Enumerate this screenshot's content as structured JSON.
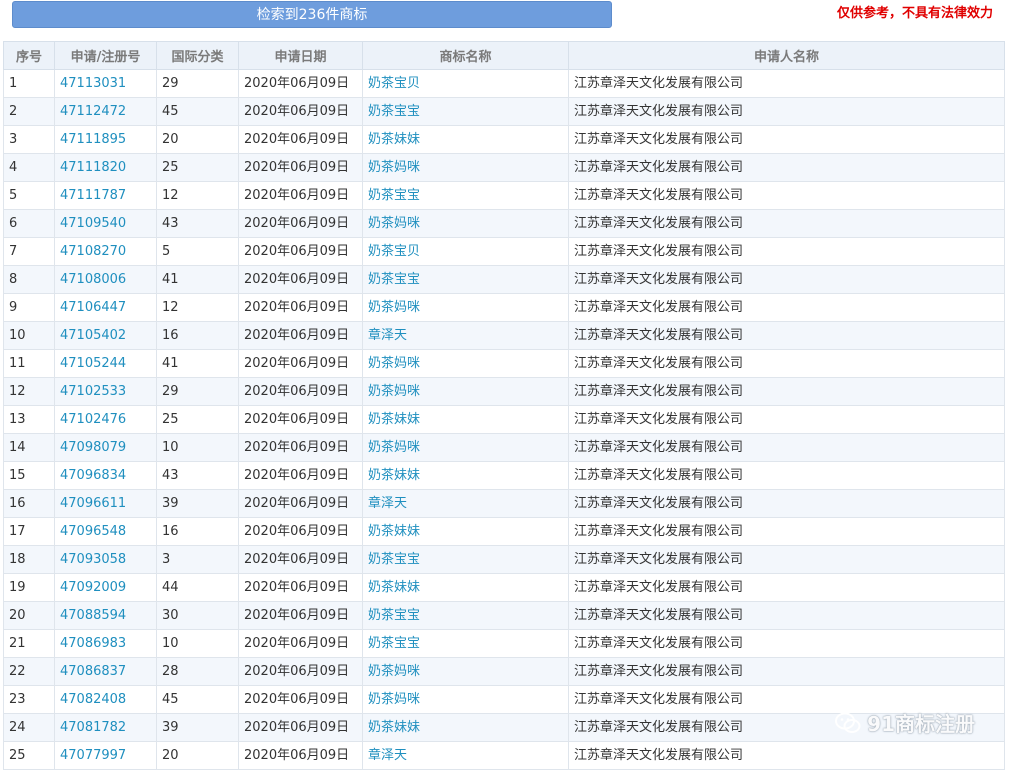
{
  "header": {
    "result_label": "检索到236件商标",
    "disclaimer": "仅供参考，不具有法律效力"
  },
  "columns": [
    "序号",
    "申请/注册号",
    "国际分类",
    "申请日期",
    "商标名称",
    "申请人名称"
  ],
  "rows": [
    {
      "no": "1",
      "reg": "47113031",
      "cls": "29",
      "date": "2020年06月09日",
      "name": "奶茶宝贝",
      "applicant": "江苏章泽天文化发展有限公司"
    },
    {
      "no": "2",
      "reg": "47112472",
      "cls": "45",
      "date": "2020年06月09日",
      "name": "奶茶宝宝",
      "applicant": "江苏章泽天文化发展有限公司"
    },
    {
      "no": "3",
      "reg": "47111895",
      "cls": "20",
      "date": "2020年06月09日",
      "name": "奶茶妹妹",
      "applicant": "江苏章泽天文化发展有限公司"
    },
    {
      "no": "4",
      "reg": "47111820",
      "cls": "25",
      "date": "2020年06月09日",
      "name": "奶茶妈咪",
      "applicant": "江苏章泽天文化发展有限公司"
    },
    {
      "no": "5",
      "reg": "47111787",
      "cls": "12",
      "date": "2020年06月09日",
      "name": "奶茶宝宝",
      "applicant": "江苏章泽天文化发展有限公司"
    },
    {
      "no": "6",
      "reg": "47109540",
      "cls": "43",
      "date": "2020年06月09日",
      "name": "奶茶妈咪",
      "applicant": "江苏章泽天文化发展有限公司"
    },
    {
      "no": "7",
      "reg": "47108270",
      "cls": "5",
      "date": "2020年06月09日",
      "name": "奶茶宝贝",
      "applicant": "江苏章泽天文化发展有限公司"
    },
    {
      "no": "8",
      "reg": "47108006",
      "cls": "41",
      "date": "2020年06月09日",
      "name": "奶茶宝宝",
      "applicant": "江苏章泽天文化发展有限公司"
    },
    {
      "no": "9",
      "reg": "47106447",
      "cls": "12",
      "date": "2020年06月09日",
      "name": "奶茶妈咪",
      "applicant": "江苏章泽天文化发展有限公司"
    },
    {
      "no": "10",
      "reg": "47105402",
      "cls": "16",
      "date": "2020年06月09日",
      "name": "章泽天",
      "applicant": "江苏章泽天文化发展有限公司"
    },
    {
      "no": "11",
      "reg": "47105244",
      "cls": "41",
      "date": "2020年06月09日",
      "name": "奶茶妈咪",
      "applicant": "江苏章泽天文化发展有限公司"
    },
    {
      "no": "12",
      "reg": "47102533",
      "cls": "29",
      "date": "2020年06月09日",
      "name": "奶茶妈咪",
      "applicant": "江苏章泽天文化发展有限公司"
    },
    {
      "no": "13",
      "reg": "47102476",
      "cls": "25",
      "date": "2020年06月09日",
      "name": "奶茶妹妹",
      "applicant": "江苏章泽天文化发展有限公司"
    },
    {
      "no": "14",
      "reg": "47098079",
      "cls": "10",
      "date": "2020年06月09日",
      "name": "奶茶妈咪",
      "applicant": "江苏章泽天文化发展有限公司"
    },
    {
      "no": "15",
      "reg": "47096834",
      "cls": "43",
      "date": "2020年06月09日",
      "name": "奶茶妹妹",
      "applicant": "江苏章泽天文化发展有限公司"
    },
    {
      "no": "16",
      "reg": "47096611",
      "cls": "39",
      "date": "2020年06月09日",
      "name": "章泽天",
      "applicant": "江苏章泽天文化发展有限公司"
    },
    {
      "no": "17",
      "reg": "47096548",
      "cls": "16",
      "date": "2020年06月09日",
      "name": "奶茶妹妹",
      "applicant": "江苏章泽天文化发展有限公司"
    },
    {
      "no": "18",
      "reg": "47093058",
      "cls": "3",
      "date": "2020年06月09日",
      "name": "奶茶宝宝",
      "applicant": "江苏章泽天文化发展有限公司"
    },
    {
      "no": "19",
      "reg": "47092009",
      "cls": "44",
      "date": "2020年06月09日",
      "name": "奶茶妹妹",
      "applicant": "江苏章泽天文化发展有限公司"
    },
    {
      "no": "20",
      "reg": "47088594",
      "cls": "30",
      "date": "2020年06月09日",
      "name": "奶茶宝宝",
      "applicant": "江苏章泽天文化发展有限公司"
    },
    {
      "no": "21",
      "reg": "47086983",
      "cls": "10",
      "date": "2020年06月09日",
      "name": "奶茶宝宝",
      "applicant": "江苏章泽天文化发展有限公司"
    },
    {
      "no": "22",
      "reg": "47086837",
      "cls": "28",
      "date": "2020年06月09日",
      "name": "奶茶妈咪",
      "applicant": "江苏章泽天文化发展有限公司"
    },
    {
      "no": "23",
      "reg": "47082408",
      "cls": "45",
      "date": "2020年06月09日",
      "name": "奶茶妈咪",
      "applicant": "江苏章泽天文化发展有限公司"
    },
    {
      "no": "24",
      "reg": "47081782",
      "cls": "39",
      "date": "2020年06月09日",
      "name": "奶茶妹妹",
      "applicant": "江苏章泽天文化发展有限公司"
    },
    {
      "no": "25",
      "reg": "47077997",
      "cls": "20",
      "date": "2020年06月09日",
      "name": "章泽天",
      "applicant": "江苏章泽天文化发展有限公司"
    }
  ],
  "watermark": {
    "text": "91商标注册",
    "icon": "wechat-icon"
  },
  "colors": {
    "button": "#6e9ddd",
    "link": "#1f8fbf",
    "disclaimer": "#e00000",
    "header_bg": "#ecf2f9",
    "row_alt": "#f3f7fc"
  }
}
